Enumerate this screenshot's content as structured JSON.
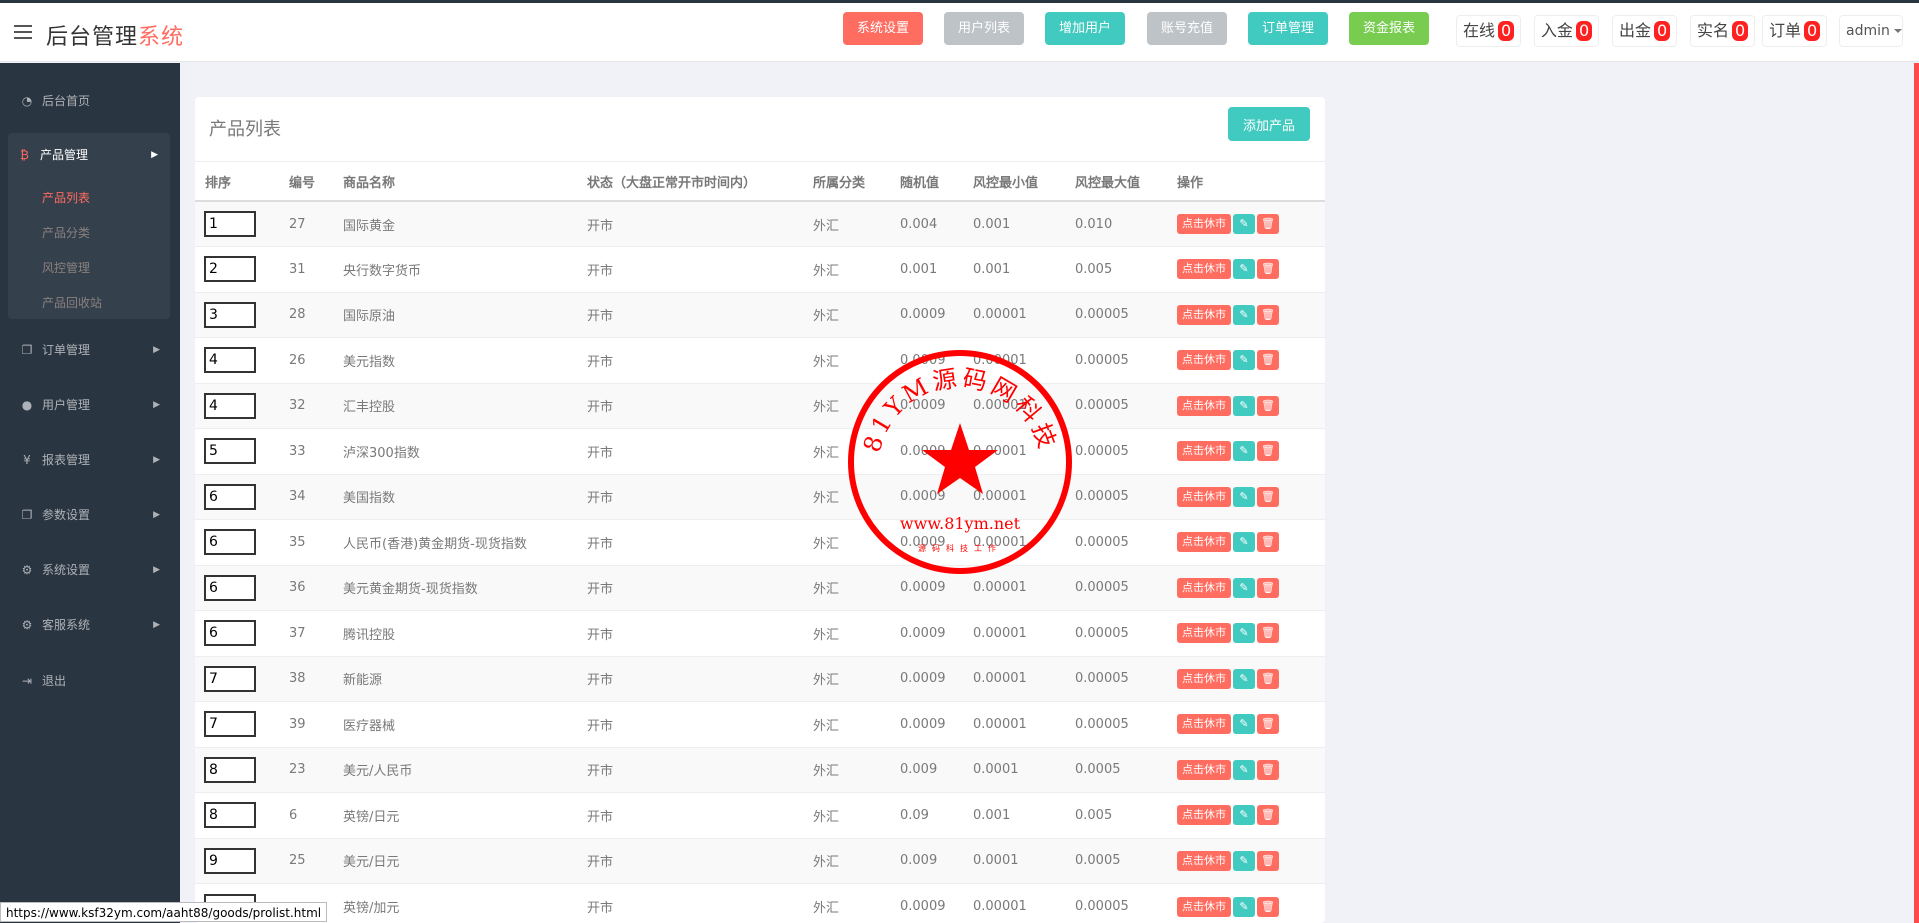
{
  "header": {
    "brand_main": "后台管理",
    "brand_accent": "系统",
    "buttons": [
      {
        "label": "系统设置",
        "color": "#ff6c60"
      },
      {
        "label": "用户列表",
        "color": "#bec3c7"
      },
      {
        "label": "增加用户",
        "color": "#41cac0"
      },
      {
        "label": "账号充值",
        "color": "#bec3c7"
      },
      {
        "label": "订单管理",
        "color": "#41cac0"
      },
      {
        "label": "资金报表",
        "color": "#78cd51"
      }
    ],
    "counters": [
      {
        "label": "在线",
        "value": "0"
      },
      {
        "label": "入金",
        "value": "0"
      },
      {
        "label": "出金",
        "value": "0"
      },
      {
        "label": "实名",
        "value": "0"
      },
      {
        "label": "订单",
        "value": "0"
      }
    ],
    "user": "admin"
  },
  "sidebar": {
    "items": [
      {
        "label": "后台首页",
        "icon": "dashboard-icon"
      },
      {
        "label": "产品管理",
        "icon": "bitcoin-icon"
      },
      {
        "label": "订单管理",
        "icon": "copy-icon"
      },
      {
        "label": "用户管理",
        "icon": "user-icon"
      },
      {
        "label": "报表管理",
        "icon": "yen-icon"
      },
      {
        "label": "参数设置",
        "icon": "copy-icon"
      },
      {
        "label": "系统设置",
        "icon": "cogs-icon"
      },
      {
        "label": "客服系统",
        "icon": "cogs-icon"
      },
      {
        "label": "退出",
        "icon": "sign-out-icon"
      }
    ],
    "submenu": [
      "产品列表",
      "产品分类",
      "风控管理",
      "产品回收站"
    ]
  },
  "panel": {
    "title": "产品列表",
    "add_button": "添加产品",
    "columns": [
      "排序",
      "编号",
      "商品名称",
      "状态（大盘正常开市时间内）",
      "所属分类",
      "随机值",
      "风控最小值",
      "风控最大值",
      "操作"
    ],
    "rows": [
      {
        "sort": "1",
        "id": "27",
        "name": "国际黄金",
        "status": "开市",
        "category": "外汇",
        "random": "0.004",
        "min": "0.001",
        "max": "0.010"
      },
      {
        "sort": "2",
        "id": "31",
        "name": "央行数字货币",
        "status": "开市",
        "category": "外汇",
        "random": "0.001",
        "min": "0.001",
        "max": "0.005"
      },
      {
        "sort": "3",
        "id": "28",
        "name": "国际原油",
        "status": "开市",
        "category": "外汇",
        "random": "0.0009",
        "min": "0.00001",
        "max": "0.00005"
      },
      {
        "sort": "4",
        "id": "26",
        "name": "美元指数",
        "status": "开市",
        "category": "外汇",
        "random": "0.0009",
        "min": "0.00001",
        "max": "0.00005"
      },
      {
        "sort": "4",
        "id": "32",
        "name": "汇丰控股",
        "status": "开市",
        "category": "外汇",
        "random": "0.0009",
        "min": "0.00001",
        "max": "0.00005"
      },
      {
        "sort": "5",
        "id": "33",
        "name": "泸深300指数",
        "status": "开市",
        "category": "外汇",
        "random": "0.0009",
        "min": "0.00001",
        "max": "0.00005"
      },
      {
        "sort": "6",
        "id": "34",
        "name": "美国指数",
        "status": "开市",
        "category": "外汇",
        "random": "0.0009",
        "min": "0.00001",
        "max": "0.00005"
      },
      {
        "sort": "6",
        "id": "35",
        "name": "人民币(香港)黄金期货-现货指数",
        "status": "开市",
        "category": "外汇",
        "random": "0.0009",
        "min": "0.00001",
        "max": "0.00005"
      },
      {
        "sort": "6",
        "id": "36",
        "name": "美元黄金期货-现货指数",
        "status": "开市",
        "category": "外汇",
        "random": "0.0009",
        "min": "0.00001",
        "max": "0.00005"
      },
      {
        "sort": "6",
        "id": "37",
        "name": "腾讯控股",
        "status": "开市",
        "category": "外汇",
        "random": "0.0009",
        "min": "0.00001",
        "max": "0.00005"
      },
      {
        "sort": "7",
        "id": "38",
        "name": "新能源",
        "status": "开市",
        "category": "外汇",
        "random": "0.0009",
        "min": "0.00001",
        "max": "0.00005"
      },
      {
        "sort": "7",
        "id": "39",
        "name": "医疗器械",
        "status": "开市",
        "category": "外汇",
        "random": "0.0009",
        "min": "0.00001",
        "max": "0.00005"
      },
      {
        "sort": "8",
        "id": "23",
        "name": "美元/人民币",
        "status": "开市",
        "category": "外汇",
        "random": "0.009",
        "min": "0.0001",
        "max": "0.0005"
      },
      {
        "sort": "8",
        "id": "6",
        "name": "英镑/日元",
        "status": "开市",
        "category": "外汇",
        "random": "0.09",
        "min": "0.001",
        "max": "0.005"
      },
      {
        "sort": "9",
        "id": "25",
        "name": "美元/日元",
        "status": "开市",
        "category": "外汇",
        "random": "0.009",
        "min": "0.0001",
        "max": "0.0005"
      },
      {
        "sort": "",
        "id": "",
        "name": "英镑/加元",
        "status": "开市",
        "category": "外汇",
        "random": "0.0009",
        "min": "0.00001",
        "max": "0.00005"
      }
    ],
    "actions": {
      "rest_label": "点击休市",
      "edit_icon": "pencil-icon",
      "delete_icon": "trash-icon"
    }
  },
  "stamp": {
    "arc_text": "81YM源码网科技",
    "url": "www.81ym.net",
    "bottom_text": "源码科技工作"
  },
  "status_bar": {
    "url": "https://www.ksf32ym.com/aaht88/goods/prolist.html"
  }
}
